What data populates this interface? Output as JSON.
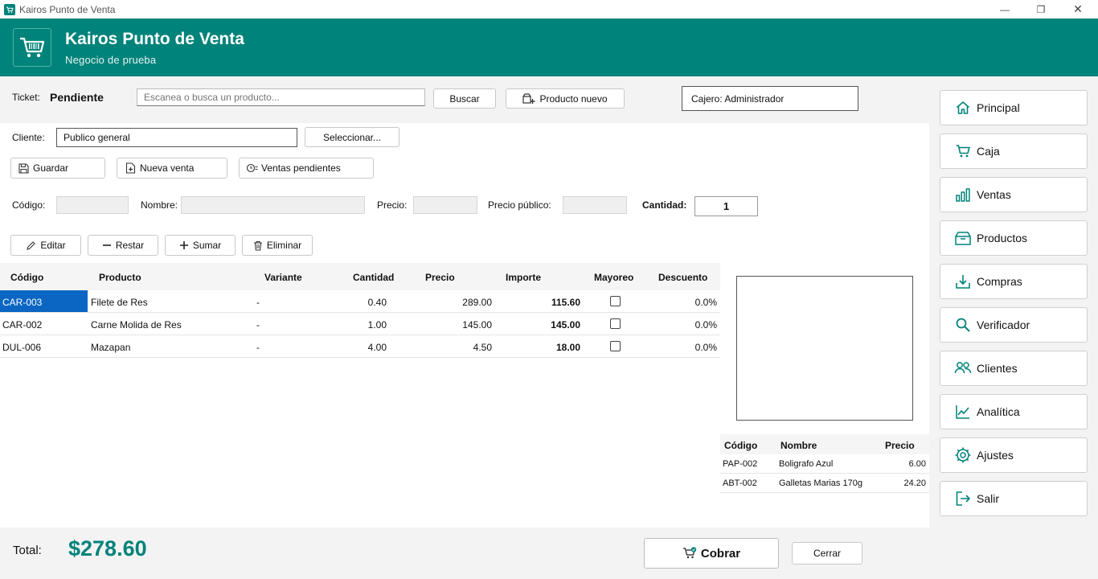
{
  "window": {
    "title": "Kairos Punto de Venta",
    "minimize_glyph": "—",
    "restore_glyph": "❐",
    "close_glyph": "✕"
  },
  "header": {
    "title": "Kairos Punto de Venta",
    "subtitle": "Negocio de prueba",
    "logo_icon": "cart-barcode-icon"
  },
  "ticket": {
    "label": "Ticket:",
    "status": "Pendiente",
    "search_placeholder": "Escanea o busca un producto...",
    "search_button": "Buscar",
    "new_product_button": "Producto nuevo",
    "cashier": "Cajero: Administrador"
  },
  "client": {
    "label": "Cliente:",
    "value": "Publico general",
    "select_button": "Seleccionar..."
  },
  "actions": {
    "save": "Guardar",
    "new_sale": "Nueva venta",
    "pending_sales": "Ventas pendientes"
  },
  "product_fields": {
    "code_label": "Código:",
    "name_label": "Nombre:",
    "price_label": "Precio:",
    "public_price_label": "Precio público:",
    "quantity_label": "Cantidad:",
    "quantity_value": "1"
  },
  "edit_actions": {
    "edit": "Editar",
    "subtract": "Restar",
    "add": "Sumar",
    "delete": "Eliminar"
  },
  "sale_table": {
    "columns": [
      "Código",
      "Producto",
      "Variante",
      "Cantidad",
      "Precio",
      "Importe",
      "Mayoreo",
      "Descuento"
    ],
    "rows": [
      {
        "code": "CAR-003",
        "product": "Filete de Res",
        "variant": "-",
        "quantity": "0.40",
        "price": "289.00",
        "amount": "115.60",
        "wholesale": false,
        "discount": "0.0%"
      },
      {
        "code": "CAR-002",
        "product": "Carne Molida de Res",
        "variant": "-",
        "quantity": "1.00",
        "price": "145.00",
        "amount": "145.00",
        "wholesale": false,
        "discount": "0.0%"
      },
      {
        "code": "DUL-006",
        "product": "Mazapan",
        "variant": "-",
        "quantity": "4.00",
        "price": "4.50",
        "amount": "18.00",
        "wholesale": false,
        "discount": "0.0%"
      }
    ]
  },
  "suggest_table": {
    "columns": [
      "Código",
      "Nombre",
      "Precio"
    ],
    "rows": [
      {
        "code": "PAP-002",
        "name": "Boligrafo Azul",
        "price": "6.00"
      },
      {
        "code": "ABT-002",
        "name": "Galletas Marias 170g",
        "price": "24.20"
      }
    ]
  },
  "footer": {
    "total_label": "Total:",
    "total_value": "$278.60",
    "charge_button": "Cobrar",
    "close_button": "Cerrar"
  },
  "sidebar": {
    "items": [
      {
        "label": "Principal",
        "icon": "home-icon"
      },
      {
        "label": "Caja",
        "icon": "cart-icon"
      },
      {
        "label": "Ventas",
        "icon": "bar-chart-icon"
      },
      {
        "label": "Productos",
        "icon": "box-icon"
      },
      {
        "label": "Compras",
        "icon": "download-tray-icon"
      },
      {
        "label": "Verificador",
        "icon": "search-icon"
      },
      {
        "label": "Clientes",
        "icon": "users-icon"
      },
      {
        "label": "Analítica",
        "icon": "line-chart-icon"
      },
      {
        "label": "Ajustes",
        "icon": "gear-icon"
      },
      {
        "label": "Salir",
        "icon": "exit-icon"
      }
    ]
  },
  "colors": {
    "brand": "#00837a",
    "selection": "#0a66c2"
  }
}
